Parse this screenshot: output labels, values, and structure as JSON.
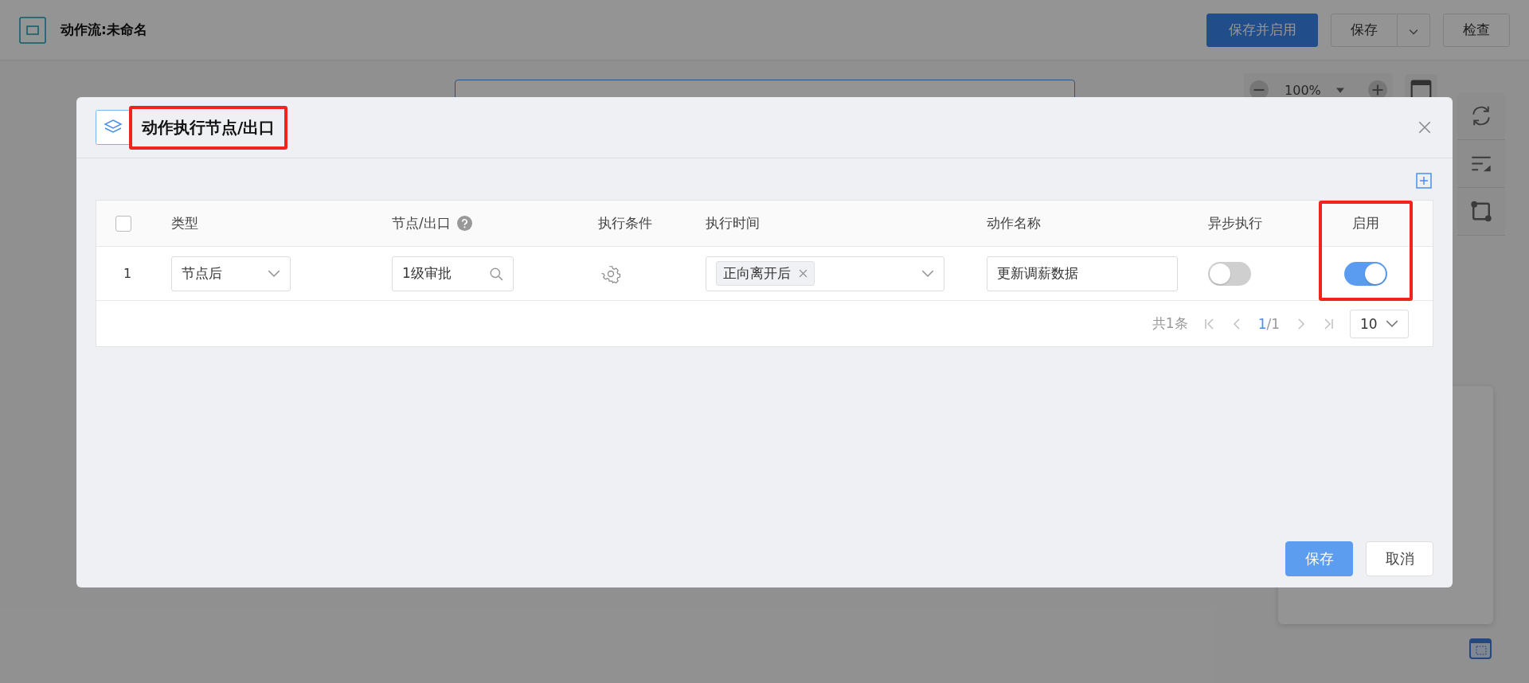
{
  "app": {
    "title": "动作流:未命名",
    "zoom": "100%",
    "buttons": [
      {
        "label": "保存并启用",
        "kind": "primary"
      },
      {
        "label": "保存",
        "kind": "split"
      },
      {
        "label": "检查",
        "kind": "plain"
      }
    ]
  },
  "dialog": {
    "title": "动作执行节点/出口",
    "title_highlighted": true,
    "table": {
      "select_all_checked": false,
      "columns": [
        {
          "label": "类型"
        },
        {
          "label": "节点/出口",
          "help": true
        },
        {
          "label": "执行条件"
        },
        {
          "label": "执行时间"
        },
        {
          "label": "动作名称"
        },
        {
          "label": "异步执行"
        },
        {
          "label": "启用",
          "highlighted": true
        }
      ],
      "rows": [
        {
          "index": "1",
          "type": "节点后",
          "node": "1级审批",
          "time_tags": [
            "正向离开后"
          ],
          "action_name": "更新调薪数据",
          "async": false,
          "enabled": true
        }
      ]
    },
    "pagination": {
      "total": "共1条",
      "current": "1",
      "pages": "/1",
      "page_size": "10"
    },
    "buttons": [
      {
        "label": "保存",
        "kind": "primary"
      },
      {
        "label": "取消",
        "kind": "plain"
      }
    ]
  }
}
